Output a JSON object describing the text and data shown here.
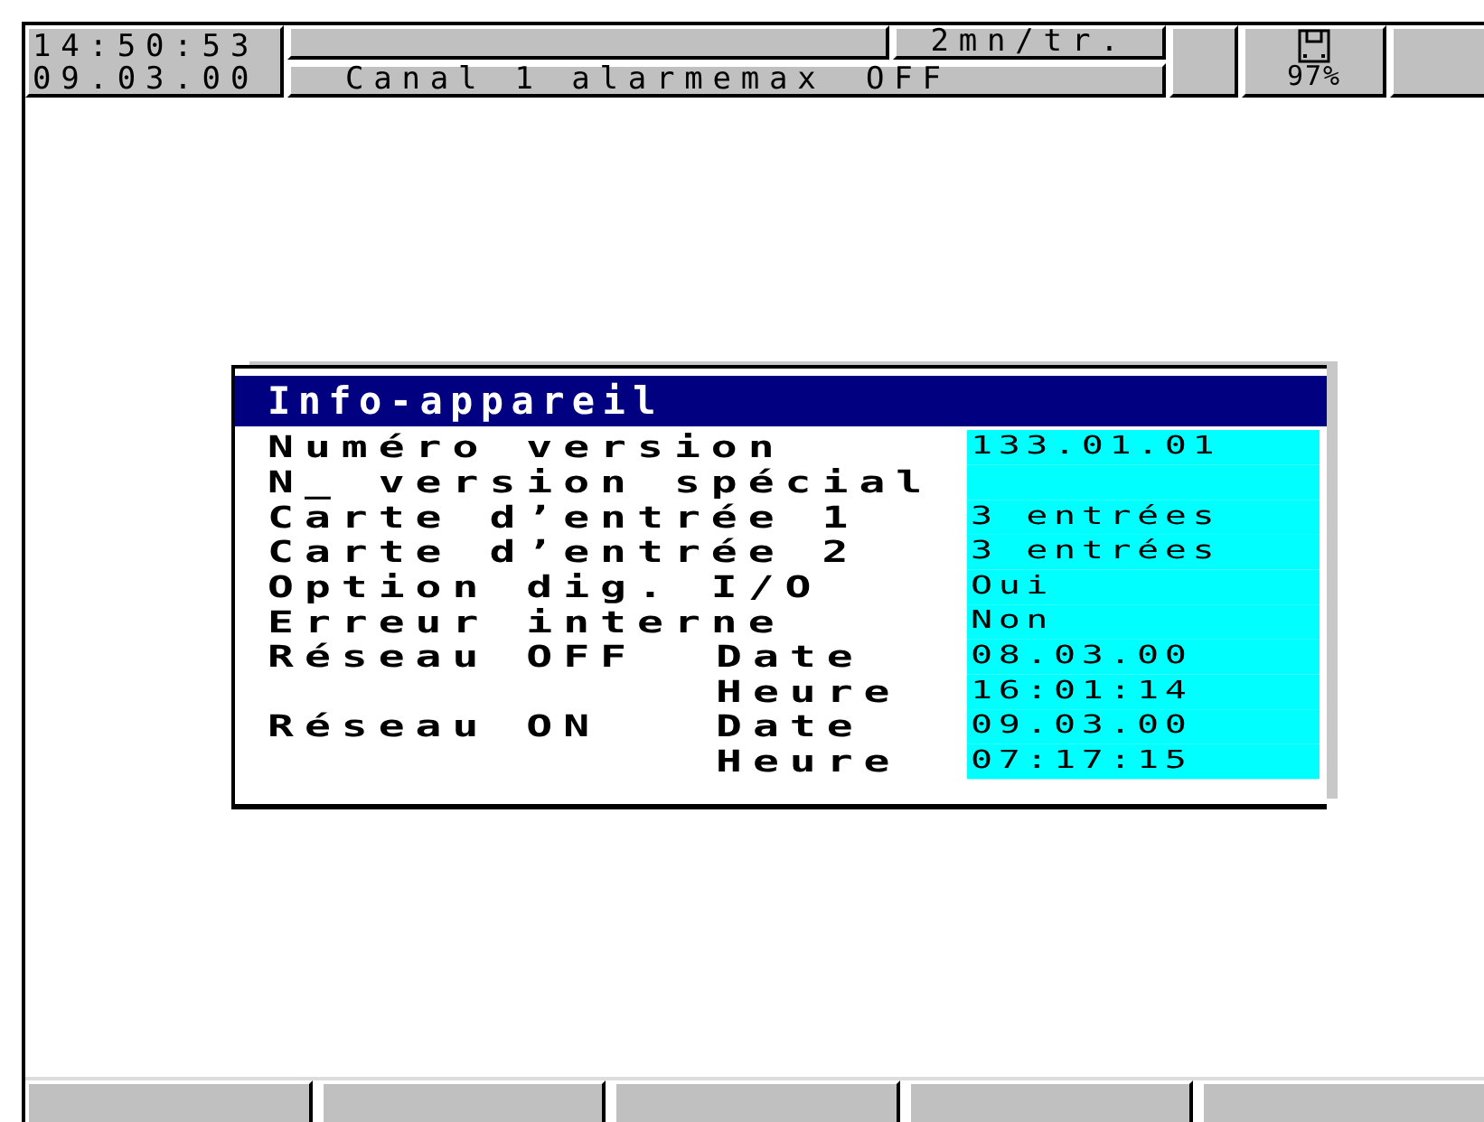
{
  "status_bar": {
    "time": "14:50:53",
    "date": "09.03.00",
    "speed": "2mn/tr.",
    "message": "Canal 1 alarmemax",
    "message_state": "OFF",
    "memory": "97%"
  },
  "dialog": {
    "title": "Info-appareil",
    "rows": [
      {
        "label": "Numéro version",
        "value": "133.01.01"
      },
      {
        "label": "N_ version spécial"
      },
      {
        "label": "Carte d’entrée 1",
        "value": "3 entrées"
      },
      {
        "label": "Carte d’entrée 2",
        "value": "3 entrées"
      },
      {
        "label": "Option dig. I/O",
        "value": "Oui"
      },
      {
        "label": "Erreur interne",
        "value": "Non"
      },
      {
        "label": "Réseau OFF",
        "sublabel": "Date",
        "value": "08.03.00"
      },
      {
        "sublabel": "Heure",
        "value": "16:01:14"
      },
      {
        "label": "Réseau ON",
        "sublabel": "Date",
        "value": "09.03.00"
      },
      {
        "sublabel": "Heure",
        "value": "07:17:15"
      }
    ]
  }
}
